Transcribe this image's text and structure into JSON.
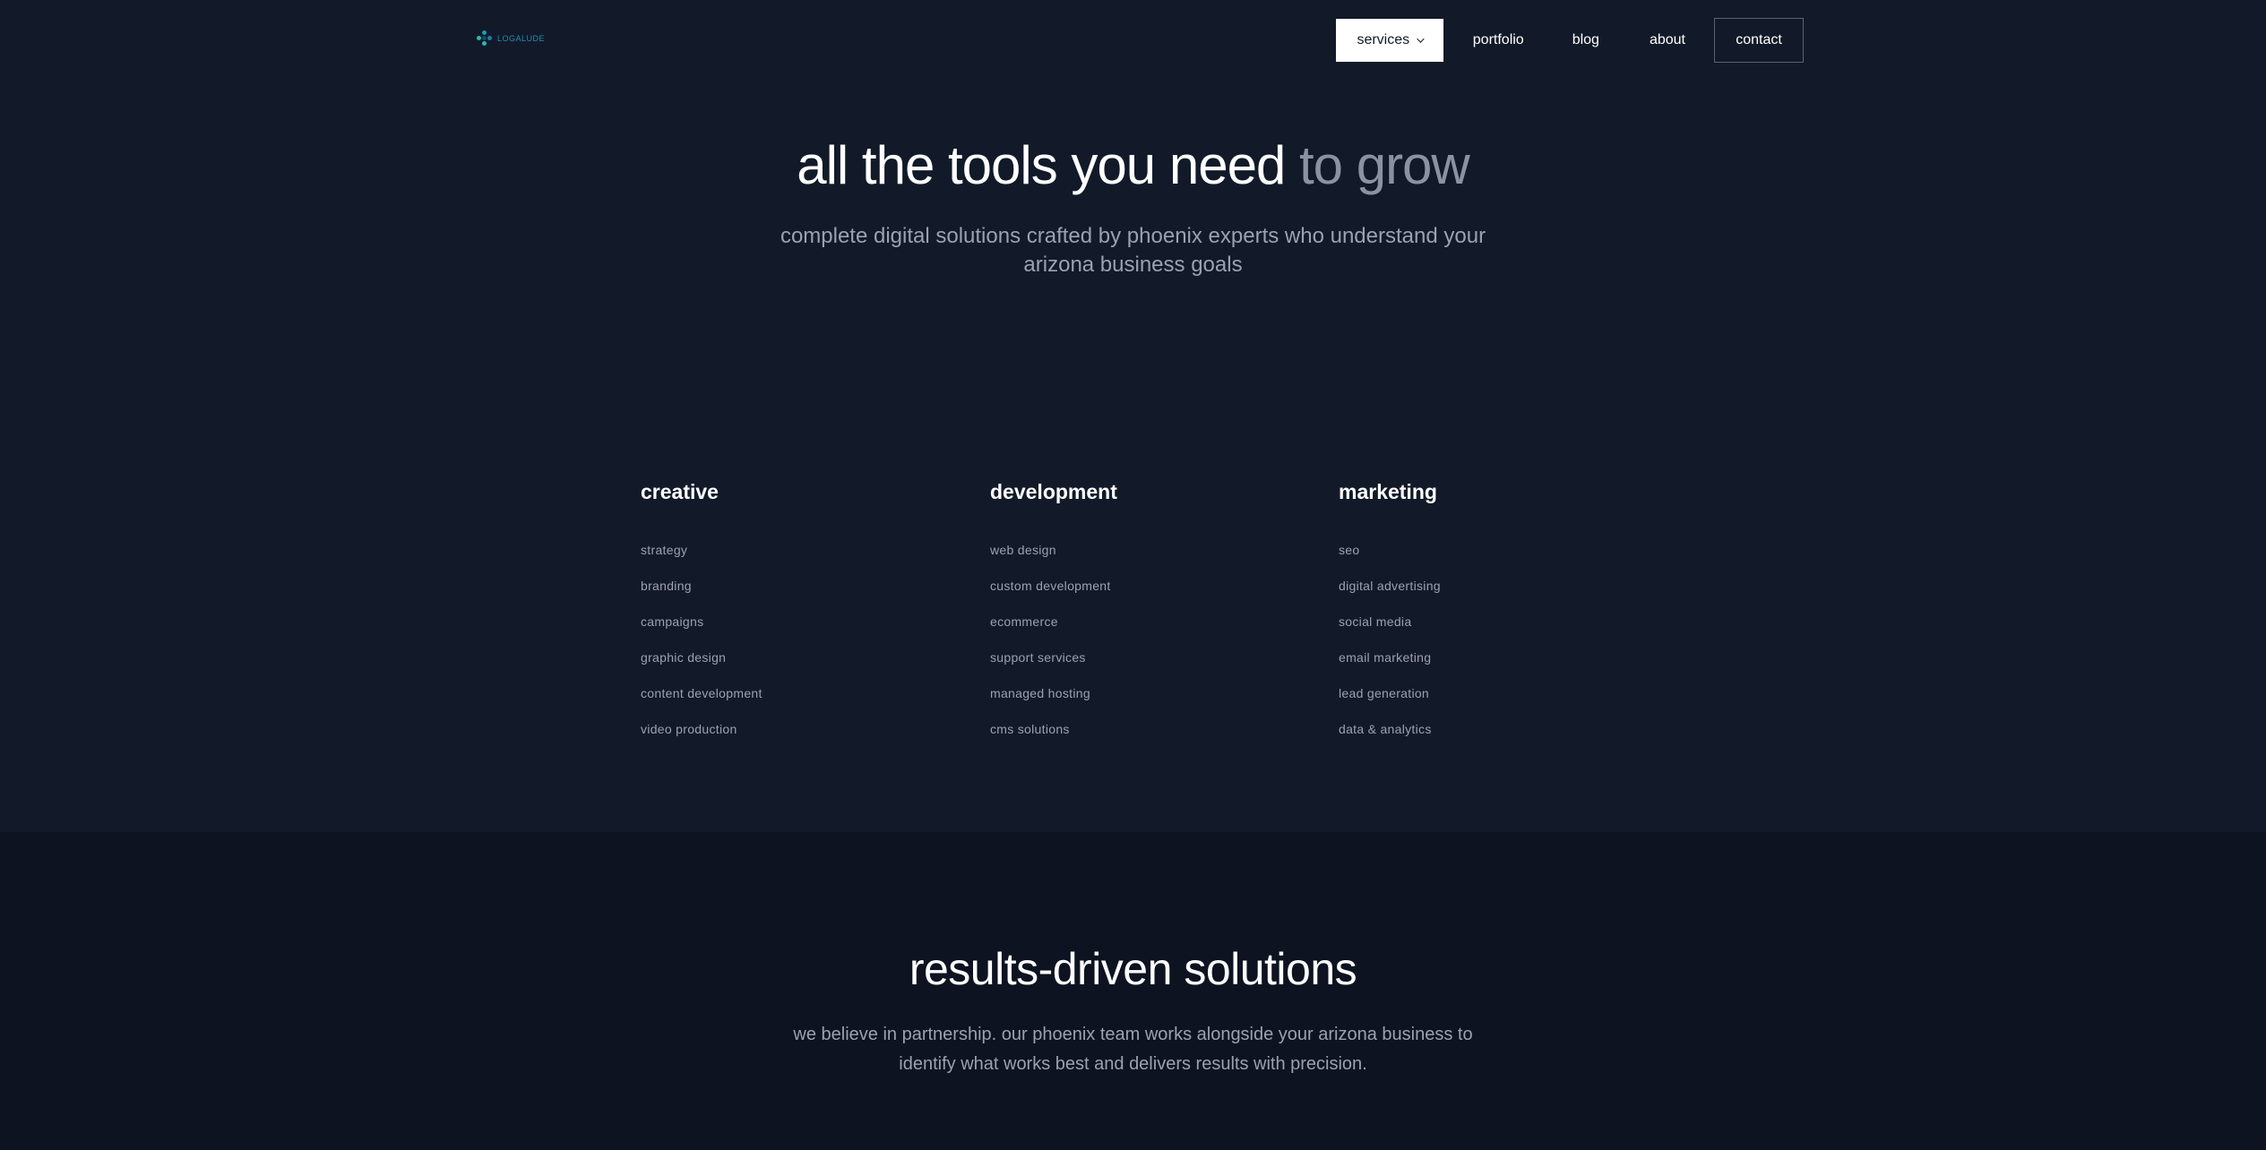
{
  "brand": {
    "logo_text": "LOGALUDE"
  },
  "nav": {
    "services": "services",
    "portfolio": "portfolio",
    "blog": "blog",
    "about": "about",
    "contact": "contact"
  },
  "hero": {
    "title_main": "all the tools you need ",
    "title_accent": "to grow",
    "subtitle_line1": "complete digital solutions crafted by phoenix experts who understand your",
    "subtitle_line2": "arizona business goals"
  },
  "columns": [
    {
      "heading": "creative",
      "items": [
        "strategy",
        "branding",
        "campaigns",
        "graphic design",
        "content development",
        "video production"
      ]
    },
    {
      "heading": "development",
      "items": [
        "web design",
        "custom development",
        "ecommerce",
        "support services",
        "managed hosting",
        "cms solutions"
      ]
    },
    {
      "heading": "marketing",
      "items": [
        "seo",
        "digital advertising",
        "social media",
        "email marketing",
        "lead generation",
        "data & analytics"
      ]
    }
  ],
  "results": {
    "title": "results-driven solutions",
    "subtitle_line1": "we believe in partnership. our phoenix team works alongside your arizona business to",
    "subtitle_line2": "identify what works best and delivers results with precision."
  },
  "colors": {
    "background": "#121a29",
    "section_background": "#0d1320",
    "muted_text": "#9aa2b1",
    "accent_logo": "#1f8fb0"
  }
}
